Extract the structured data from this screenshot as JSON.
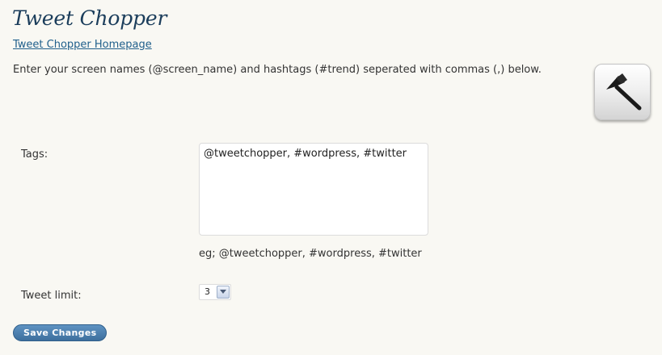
{
  "header": {
    "title": "Tweet Chopper",
    "homepage_link": "Tweet Chopper Homepage",
    "intro": "Enter your screen names (@screen_name) and hashtags (#trend) seperated with commas (,) below."
  },
  "logo": {
    "icon": "axe-icon"
  },
  "form": {
    "tags": {
      "label": "Tags:",
      "value": "@tweetchopper, #wordpress, #twitter",
      "hint": "eg; @tweetchopper, #wordpress, #twitter"
    },
    "tweet_limit": {
      "label": "Tweet limit:",
      "selected": "3"
    },
    "save_label": "Save Changes"
  },
  "colors": {
    "title": "#1b3d5b",
    "link": "#21608c",
    "button": "#4a7db0",
    "background": "#f9f8f3"
  }
}
